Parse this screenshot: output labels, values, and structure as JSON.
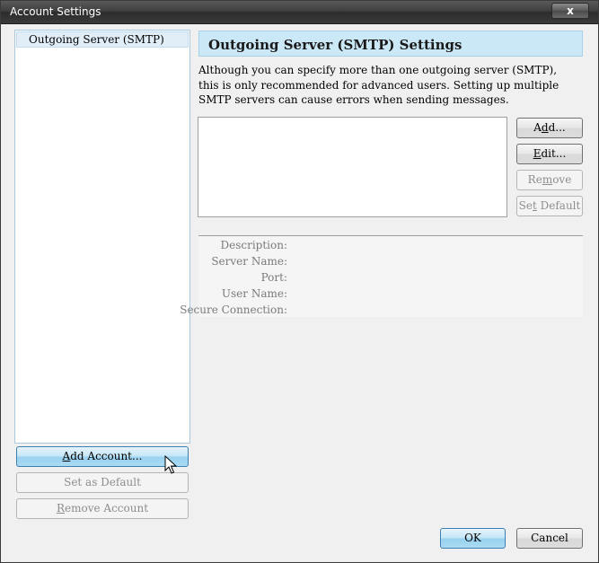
{
  "window": {
    "title": "Account Settings",
    "close_label": "x"
  },
  "sidebar": {
    "items": [
      {
        "label": "Outgoing Server (SMTP)",
        "selected": true
      }
    ],
    "add_account_pre": "",
    "add_account_access": "A",
    "add_account_post": "dd Account...",
    "set_default_label": "Set as Default",
    "remove_account_access": "R",
    "remove_account_post": "emove Account"
  },
  "main": {
    "heading": "Outgoing Server (SMTP) Settings",
    "description": "Although you can specify more than one outgoing server (SMTP), this is only recommended for advanced users. Setting up multiple SMTP servers can cause errors when sending messages.",
    "buttons": {
      "add_pre": "A",
      "add_access": "d",
      "add_post": "d...",
      "edit_access": "E",
      "edit_post": "dit...",
      "remove_pre": "Re",
      "remove_access": "m",
      "remove_post": "ove",
      "set_default_pre": "Se",
      "set_default_access": "t",
      "set_default_post": " Default"
    },
    "details": {
      "description_label": "Description:",
      "server_name_label": "Server Name:",
      "port_label": "Port:",
      "user_name_label": "User Name:",
      "secure_connection_label": "Secure Connection:"
    }
  },
  "footer": {
    "ok_label": "OK",
    "cancel_label": "Cancel"
  },
  "colors": {
    "accent_blue": "#cbe8f6",
    "selection": "#e1eef8"
  }
}
